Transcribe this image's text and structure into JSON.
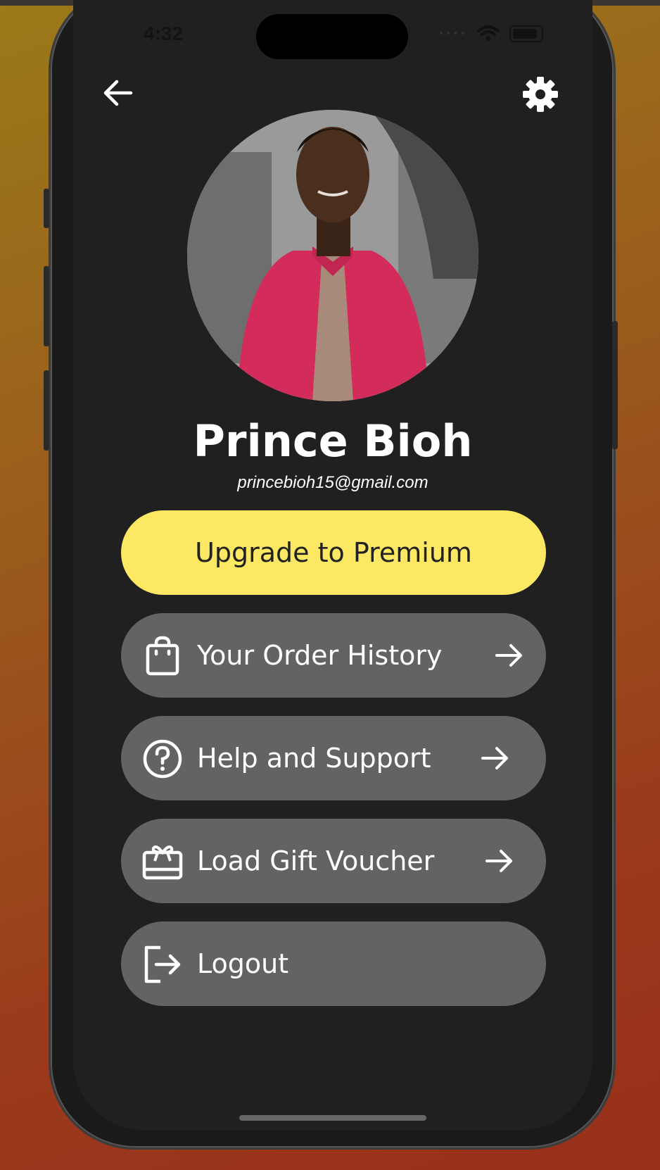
{
  "status_bar": {
    "time": "4:32"
  },
  "header": {
    "back_icon": "arrow-left-icon",
    "settings_icon": "gear-icon"
  },
  "profile": {
    "name": "Prince Bioh",
    "email": "princebioh15@gmail.com"
  },
  "menu": {
    "premium_label": "Upgrade to Premium",
    "items": [
      {
        "label": "Your Order History",
        "icon": "shopping-bag-icon"
      },
      {
        "label": "Help and Support",
        "icon": "help-circle-icon"
      },
      {
        "label": "Load Gift Voucher",
        "icon": "gift-card-icon"
      },
      {
        "label": "Logout",
        "icon": "logout-icon"
      }
    ]
  },
  "colors": {
    "screen_bg": "#202020",
    "premium_button": "#fce863",
    "menu_button": "#636363"
  }
}
